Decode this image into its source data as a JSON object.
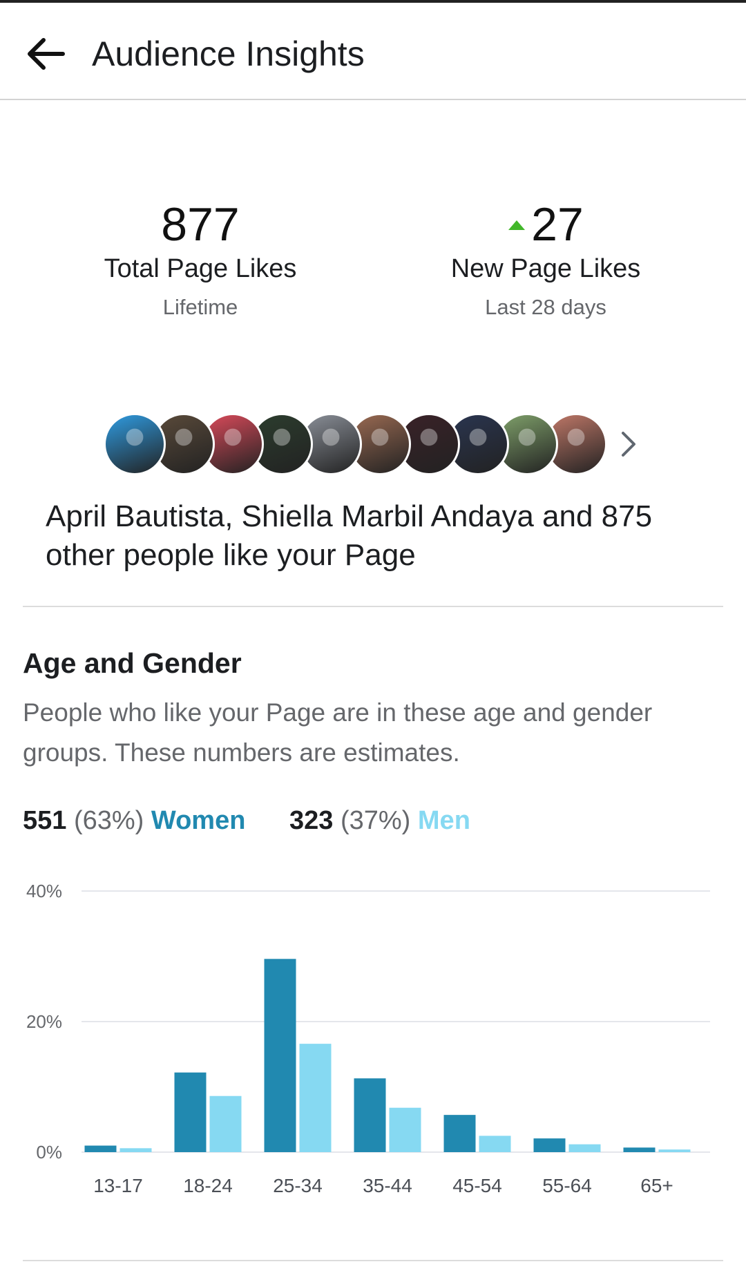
{
  "header": {
    "title": "Audience Insights",
    "back_icon": "arrow-left-icon"
  },
  "stats": {
    "total": {
      "value": "877",
      "label": "Total Page Likes",
      "period": "Lifetime"
    },
    "new": {
      "value": "27",
      "label": "New Page Likes",
      "period": "Last 28 days",
      "trend_icon": "triangle-up-icon",
      "trend_color": "#42b72a"
    }
  },
  "likers": {
    "text": "April Bautista, Shiella Marbil Andaya and 875 other people like your Page",
    "avatar_colors": [
      "#2f9be0",
      "#5a4a3a",
      "#d94a5a",
      "#2c3d2e",
      "#8a8f98",
      "#9a6a52",
      "#3a2228",
      "#2a3550",
      "#7fa06a",
      "#c07868"
    ],
    "more_icon": "chevron-right-icon"
  },
  "age_gender": {
    "title": "Age and Gender",
    "description": "People who like your Page are in these age and gender groups. These numbers are estimates.",
    "women": {
      "count": "551",
      "pct": "(63%)",
      "label": "Women",
      "color": "#2189b0"
    },
    "men": {
      "count": "323",
      "pct": "(37%)",
      "label": "Men",
      "color": "#86d9f2"
    }
  },
  "chart_data": {
    "type": "bar",
    "categories": [
      "13-17",
      "18-24",
      "25-34",
      "35-44",
      "45-54",
      "55-64",
      "65+"
    ],
    "series": [
      {
        "name": "Women",
        "values": [
          1.0,
          12.2,
          29.6,
          11.3,
          5.7,
          2.1,
          0.7
        ],
        "color": "#2189b0"
      },
      {
        "name": "Men",
        "values": [
          0.6,
          8.6,
          16.6,
          6.8,
          2.5,
          1.2,
          0.4
        ],
        "color": "#86d9f2"
      }
    ],
    "y_ticks": [
      "40%",
      "20%",
      "0%"
    ],
    "ylim": [
      0,
      40
    ],
    "grid": true,
    "title": "",
    "xlabel": "",
    "ylabel": ""
  }
}
